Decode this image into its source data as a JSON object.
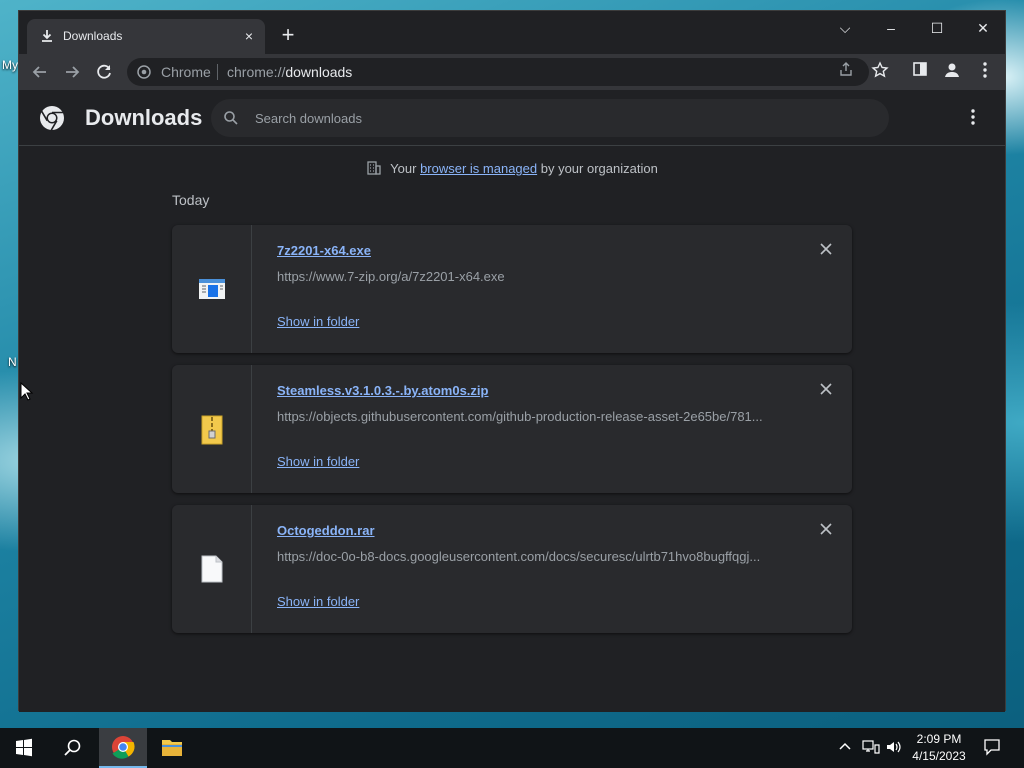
{
  "desktop": {
    "labels": [
      "My",
      "N"
    ]
  },
  "browser": {
    "tab": {
      "title": "Downloads",
      "close": "×"
    },
    "new_tab": "+",
    "window_controls": {
      "menu": "⌵",
      "minimize": "–",
      "maximize": "☐",
      "close": "✕"
    },
    "omnibox": {
      "chip": "Chrome",
      "url_prefix": "chrome://",
      "url_path": "downloads"
    }
  },
  "downloads_page": {
    "title": "Downloads",
    "search_placeholder": "Search downloads",
    "managed_notice": {
      "prefix": "Your ",
      "link": "browser is managed",
      "suffix": " by your organization"
    },
    "section": "Today",
    "items": [
      {
        "filename": "7z2201-x64.exe",
        "url": "https://www.7-zip.org/a/7z2201-x64.exe",
        "action": "Show in folder",
        "icon": "exe-installer-icon"
      },
      {
        "filename": "Steamless.v3.1.0.3.-.by.atom0s.zip",
        "url": "https://objects.githubusercontent.com/github-production-release-asset-2e65be/781...",
        "action": "Show in folder",
        "icon": "zip-archive-icon"
      },
      {
        "filename": "Octogeddon.rar",
        "url": "https://doc-0o-b8-docs.googleusercontent.com/docs/securesc/ulrtb71hvo8bugffqgj...",
        "action": "Show in folder",
        "icon": "blank-file-icon"
      }
    ]
  },
  "taskbar": {
    "time": "2:09 PM",
    "date": "4/15/2023"
  },
  "colors": {
    "link": "#8ab4f8",
    "page_bg": "#202124",
    "card_bg": "#292a2d"
  }
}
